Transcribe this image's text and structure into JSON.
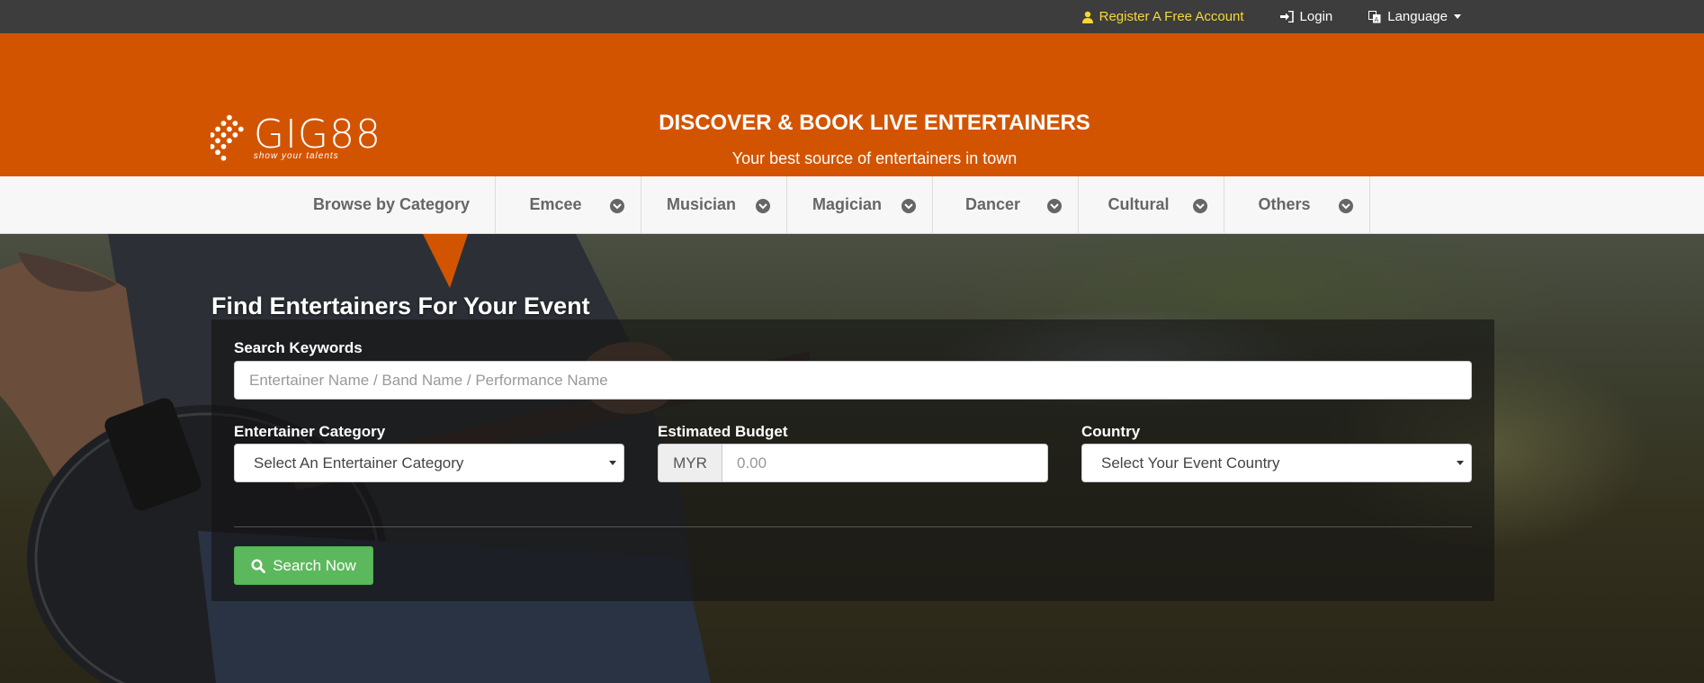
{
  "topbar": {
    "register_label": "Register A Free Account",
    "login_label": "Login",
    "language_label": "Language"
  },
  "header": {
    "logo_text": "GIG88",
    "logo_tagline": "show your talents",
    "title": "DISCOVER & BOOK LIVE ENTERTAINERS",
    "subtitle": "Your best source of entertainers in town"
  },
  "category_nav": {
    "browse_label": "Browse by Category",
    "categories": [
      {
        "label": "Emcee"
      },
      {
        "label": "Musician"
      },
      {
        "label": "Magician"
      },
      {
        "label": "Dancer"
      },
      {
        "label": "Cultural"
      },
      {
        "label": "Others"
      }
    ]
  },
  "search": {
    "heading": "Find Entertainers For Your Event",
    "keywords_label": "Search Keywords",
    "keywords_placeholder": "Entertainer Name / Band Name / Performance Name",
    "category_label": "Entertainer Category",
    "category_selected": "Select An Entertainer Category",
    "budget_label": "Estimated Budget",
    "budget_currency": "MYR",
    "budget_placeholder": "0.00",
    "country_label": "Country",
    "country_selected": "Select Your Event Country",
    "search_button_label": "Search Now"
  },
  "colors": {
    "topbar": "#3d3d3d",
    "brand_orange": "#d35400",
    "register_link": "#f5d73a",
    "search_button": "#5cb85c"
  }
}
